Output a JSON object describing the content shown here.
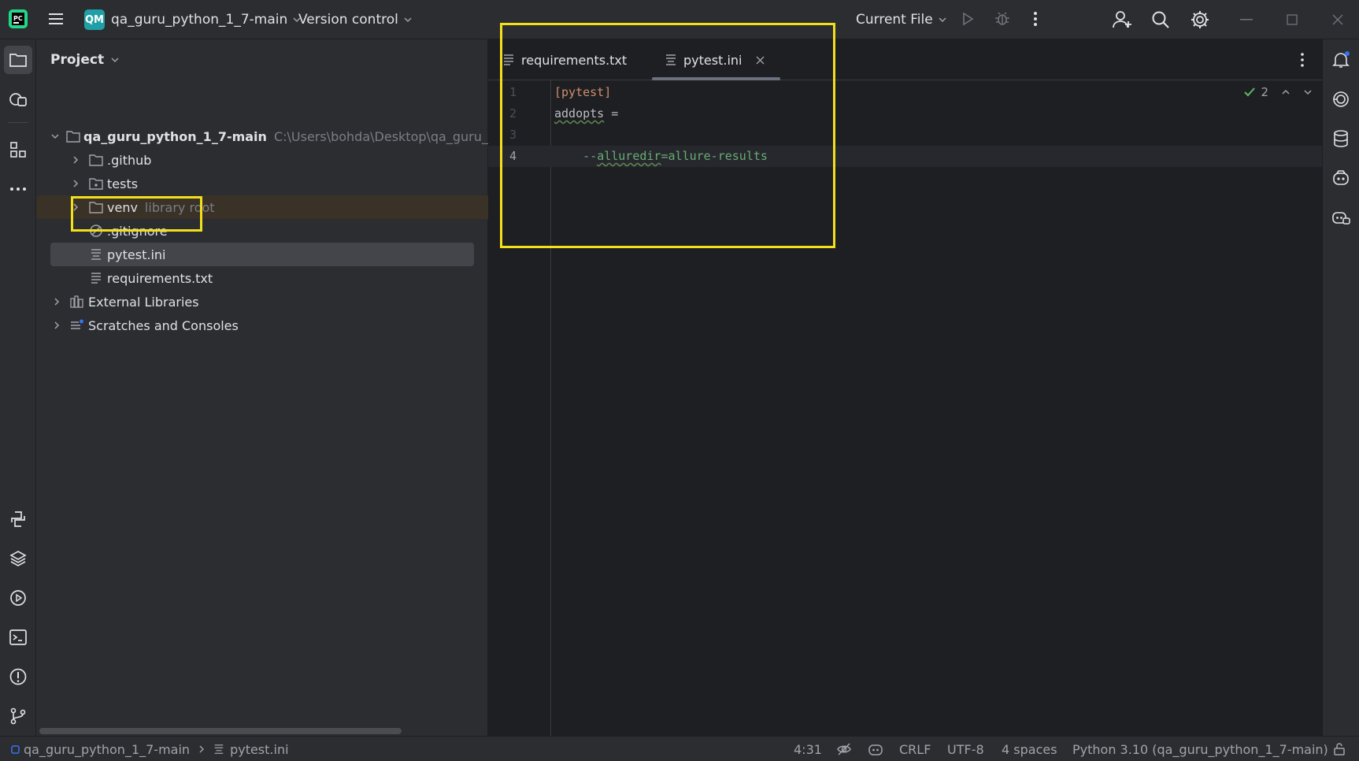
{
  "titlebar": {
    "project_badge": "QM",
    "project_name": "qa_guru_python_1_7-main",
    "vcs": "Version control",
    "run_config": "Current File",
    "icons": [
      "pycharm-logo-icon",
      "main-menu-icon",
      "run-icon",
      "debug-icon",
      "more-vertical-icon",
      "add-user-icon",
      "search-icon",
      "settings-gear-icon",
      "minimize-icon",
      "maximize-icon",
      "close-icon"
    ]
  },
  "project_panel": {
    "title": "Project",
    "root": {
      "name": "qa_guru_python_1_7-main",
      "path": "C:\\Users\\bohda\\Desktop\\qa_guru_p"
    },
    "items": [
      {
        "name": ".github",
        "type": "folder"
      },
      {
        "name": "tests",
        "type": "folder"
      },
      {
        "name": "venv",
        "note": "library root",
        "type": "folder"
      },
      {
        "name": ".gitignore",
        "type": "ignore-file"
      },
      {
        "name": "pytest.ini",
        "type": "text-file",
        "selected": true
      },
      {
        "name": "requirements.txt",
        "type": "text-file"
      }
    ],
    "external_libraries": "External Libraries",
    "scratches": "Scratches and Consoles"
  },
  "editor": {
    "tabs": [
      {
        "label": "requirements.txt",
        "active": false
      },
      {
        "label": "pytest.ini",
        "active": true
      }
    ],
    "inspection_count": "2",
    "current_line": 4,
    "lines": [
      {
        "number": "1",
        "section": "[pytest]"
      },
      {
        "number": "2",
        "key": "addopts",
        "equals": " ="
      },
      {
        "number": "3"
      },
      {
        "number": "4",
        "prefix": "    --",
        "flag": "alluredir",
        "rest": "=allure-results"
      }
    ]
  },
  "statusbar": {
    "breadcrumb_project": "qa_guru_python_1_7-main",
    "breadcrumb_file": "pytest.ini",
    "caret": "4:31",
    "line_separator": "CRLF",
    "encoding": "UTF-8",
    "indent": "4 spaces",
    "interpreter": "Python 3.10 (qa_guru_python_1_7-main)"
  },
  "colors": {
    "highlight_box": "#f2e01a",
    "accent_teal": "#20a0a6",
    "notification_dot": "#3574f0"
  }
}
